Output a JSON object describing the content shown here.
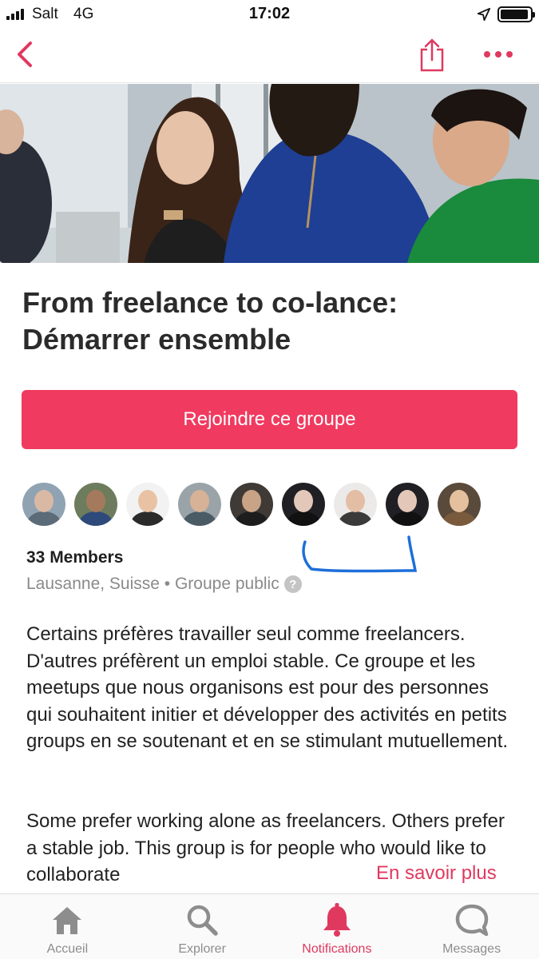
{
  "status_bar": {
    "carrier": "Salt",
    "network": "4G",
    "time": "17:02",
    "battery_level": 0.95
  },
  "nav": {
    "back_icon": "chevron-left-icon",
    "share_icon": "share-icon",
    "more_icon": "more-dots-icon"
  },
  "group": {
    "title_line1": "From freelance to co-lance:",
    "title_line2": "Démarrer ensemble",
    "join_label": "Rejoindre ce groupe",
    "members": "33 Members",
    "location": "Lausanne, Suisse • Groupe public",
    "help_glyph": "?",
    "description_fr": "Certains préfères travailler seul comme freelancers. D'autres préfèrent un emploi stable. Ce groupe et les meetups que nous organisons est pour des personnes qui souhaitent initier et développer des activités en petits groups en se soutenant et en se stimulant mutuellement.",
    "description_en": "Some prefer working alone as freelancers. Others prefer a stable job. This group is for people who would like to collaborate",
    "read_more": "En savoir plus"
  },
  "avatars": [
    {
      "bg": "#8fa3b3",
      "skin": "#d9b9a4",
      "shirt": "#5c6b78"
    },
    {
      "bg": "#6d7c5c",
      "skin": "#a57a5c",
      "shirt": "#2e4a7a"
    },
    {
      "bg": "#f2f2f2",
      "skin": "#e8c2a3",
      "shirt": "#2b2b2b"
    },
    {
      "bg": "#9aa3a8",
      "skin": "#d7b296",
      "shirt": "#4b5b66"
    },
    {
      "bg": "#3f3a36",
      "skin": "#c9a386",
      "shirt": "#1d1d1d"
    },
    {
      "bg": "#1f1f24",
      "skin": "#e3c7b8",
      "shirt": "#111111"
    },
    {
      "bg": "#eceae8",
      "skin": "#e4bda5",
      "shirt": "#3a3a3a"
    },
    {
      "bg": "#1f1f24",
      "skin": "#e3c7b8",
      "shirt": "#111111"
    },
    {
      "bg": "#5a4a3c",
      "skin": "#e5c09e",
      "shirt": "#7a5a3c"
    }
  ],
  "tabs": [
    {
      "label": "Accueil",
      "icon": "home-icon"
    },
    {
      "label": "Explorer",
      "icon": "search-icon"
    },
    {
      "label": "Notifications",
      "icon": "bell-icon",
      "active": true
    },
    {
      "label": "Messages",
      "icon": "chat-bubble-icon"
    }
  ],
  "colors": {
    "accent": "#f13a5f",
    "annotation": "#1e6fd9"
  }
}
